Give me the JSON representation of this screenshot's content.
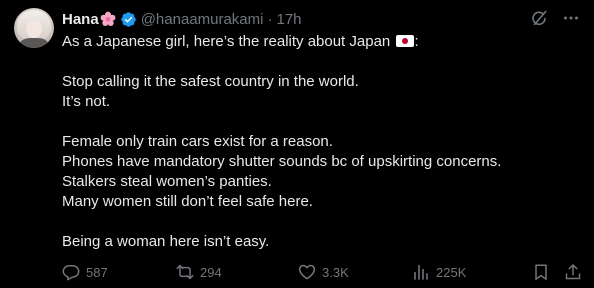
{
  "author": {
    "display_name": "Hana",
    "handle": "@hanaamurakami",
    "separator": "·",
    "time": "17h"
  },
  "tweet": {
    "lines": [
      "As a Japanese girl, here’s the reality about Japan",
      ":",
      "Stop calling it the safest country in the world.",
      "It’s not.",
      "Female only train cars exist for a reason.",
      "Phones have mandatory shutter sounds bc of upskirting concerns.",
      "Stalkers steal women’s panties.",
      "Many women still don’t feel safe here.",
      "Being a woman here isn’t easy."
    ]
  },
  "stats": {
    "replies": "587",
    "reposts": "294",
    "likes": "3.3K",
    "views": "225K"
  },
  "icons": {
    "name_emoji": "cherry-blossom-icon",
    "verified": "verified-badge-icon",
    "flag": "japan-flag-icon",
    "grok": "grok-icon",
    "more": "more-icon",
    "reply": "reply-icon",
    "repost": "repost-icon",
    "like": "heart-icon",
    "views": "views-icon",
    "bookmark": "bookmark-icon",
    "share": "share-icon"
  },
  "colors": {
    "background": "#000000",
    "text_primary": "#e7e9ea",
    "text_secondary": "#71767b",
    "verified_blue": "#1d9bf0"
  }
}
